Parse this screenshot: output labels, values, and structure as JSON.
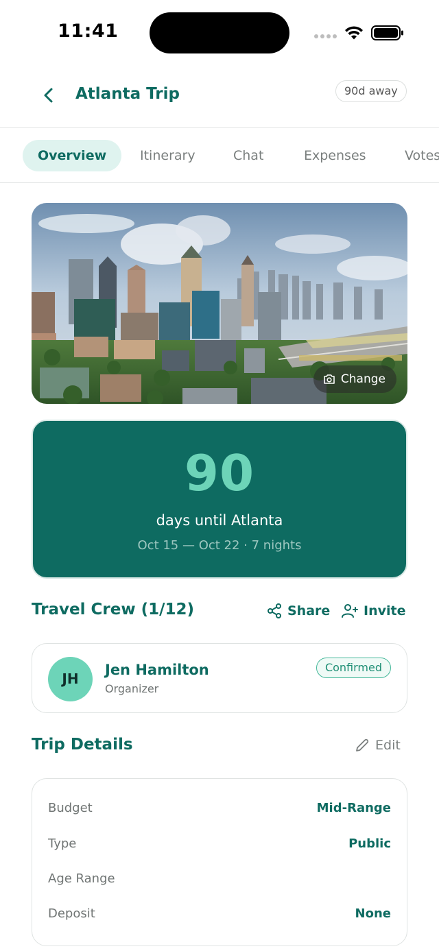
{
  "status_bar": {
    "time": "11:41"
  },
  "header": {
    "title": "Atlanta Trip",
    "badge": "90d away"
  },
  "tabs": [
    {
      "label": "Overview",
      "active": true
    },
    {
      "label": "Itinerary",
      "active": false
    },
    {
      "label": "Chat",
      "active": false
    },
    {
      "label": "Expenses",
      "active": false
    },
    {
      "label": "Votes",
      "active": false
    }
  ],
  "hero": {
    "change_label": "Change",
    "icon": "camera-icon"
  },
  "countdown": {
    "days": "90",
    "label": "days until Atlanta",
    "dates": "Oct 15 — Oct 22 · 7 nights"
  },
  "crew": {
    "title": "Travel Crew (1/12)",
    "share_label": "Share",
    "invite_label": "Invite",
    "members": [
      {
        "initials": "JH",
        "name": "Jen Hamilton",
        "role": "Organizer",
        "status": "Confirmed"
      }
    ]
  },
  "details": {
    "title": "Trip Details",
    "edit_label": "Edit",
    "rows": [
      {
        "label": "Budget",
        "value": "Mid-Range"
      },
      {
        "label": "Type",
        "value": "Public"
      },
      {
        "label": "Age Range",
        "value": ""
      },
      {
        "label": "Deposit",
        "value": "None"
      }
    ]
  },
  "colors": {
    "accent": "#0e6b61",
    "accent_light": "#6dd4b8",
    "tab_active_bg": "#dff3ef"
  }
}
